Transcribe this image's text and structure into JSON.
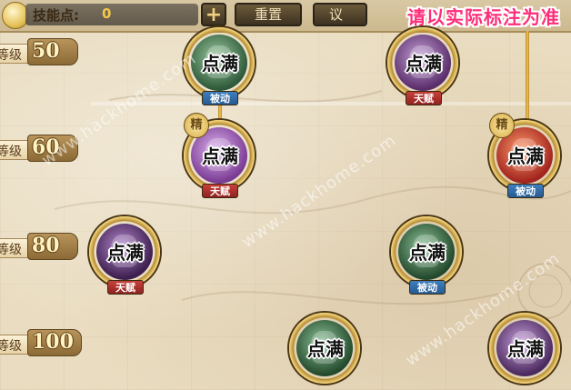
{
  "topbar": {
    "skill_points_label": "技能点:",
    "skill_points_value": "0",
    "plus_label": "+",
    "reset_label": "重置",
    "third_button_label": "议",
    "notice": "请以实际标注为准"
  },
  "levels": [
    {
      "word": "等级",
      "num": "50"
    },
    {
      "word": "等级",
      "num": "60"
    },
    {
      "word": "等级",
      "num": "80"
    },
    {
      "word": "等级",
      "num": "100"
    }
  ],
  "nodes": [
    {
      "name": "node-lv50-left",
      "maxed": "点满",
      "badge": "被动",
      "badge_type": "passive",
      "jing": "",
      "c1": "#9cc9a0",
      "c2": "#2f5a3a"
    },
    {
      "name": "node-lv50-right",
      "maxed": "点满",
      "badge": "天赋",
      "badge_type": "talent",
      "jing": "",
      "c1": "#c7a3d8",
      "c2": "#5a2e6b"
    },
    {
      "name": "node-lv60-left",
      "maxed": "点满",
      "badge": "天赋",
      "badge_type": "talent",
      "jing": "精",
      "c1": "#e0b6ef",
      "c2": "#7a3b94"
    },
    {
      "name": "node-lv60-right",
      "maxed": "点满",
      "badge": "被动",
      "badge_type": "passive",
      "jing": "精",
      "c1": "#ff9a6a",
      "c2": "#a1241e"
    },
    {
      "name": "node-lv80-left",
      "maxed": "点满",
      "badge": "天赋",
      "badge_type": "talent",
      "jing": "",
      "c1": "#b68ad0",
      "c2": "#3d1f4e"
    },
    {
      "name": "node-lv80-right",
      "maxed": "点满",
      "badge": "被动",
      "badge_type": "passive",
      "jing": "",
      "c1": "#8fc39a",
      "c2": "#23492c"
    },
    {
      "name": "node-lv100-mid",
      "maxed": "点满",
      "badge": "",
      "badge_type": "",
      "jing": "",
      "c1": "#8fc39a",
      "c2": "#234a2c"
    },
    {
      "name": "node-lv100-right",
      "maxed": "点满",
      "badge": "",
      "badge_type": "",
      "jing": "",
      "c1": "#c9a0dc",
      "c2": "#4b2a5e"
    }
  ],
  "watermarks": [
    "www.hackhome.com",
    "www.hackhome.com",
    "www.hackhome.com"
  ],
  "colors": {
    "notice": "#ff2d78",
    "skill_value": "#f2c94c",
    "connector": "#f3c650"
  }
}
